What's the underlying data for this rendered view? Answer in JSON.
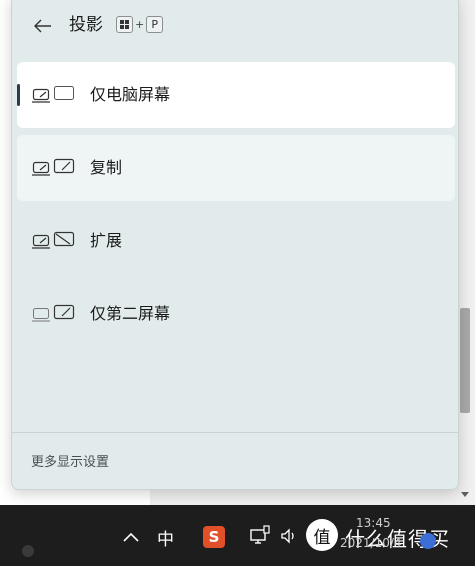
{
  "panel": {
    "title": "投影",
    "shortcut": {
      "plus": "+",
      "key": "P"
    },
    "options": [
      {
        "label": "仅电脑屏幕",
        "state": "selected"
      },
      {
        "label": "复制",
        "state": "hover"
      },
      {
        "label": "扩展",
        "state": "normal"
      },
      {
        "label": "仅第二屏幕",
        "state": "normal"
      }
    ],
    "footer_link": "更多显示设置"
  },
  "taskbar": {
    "ime": "中",
    "sogou": "S",
    "watermark_logo": "值",
    "watermark_text": "什么值得买",
    "time": "13:45",
    "date": "2021/10/4"
  },
  "colors": {
    "panel_bg": "#e2ebec",
    "selected_bg": "#ffffff",
    "indicator": "#2d3c4b",
    "taskbar_bg": "#1d1d1d",
    "sogou": "#e2502a"
  }
}
